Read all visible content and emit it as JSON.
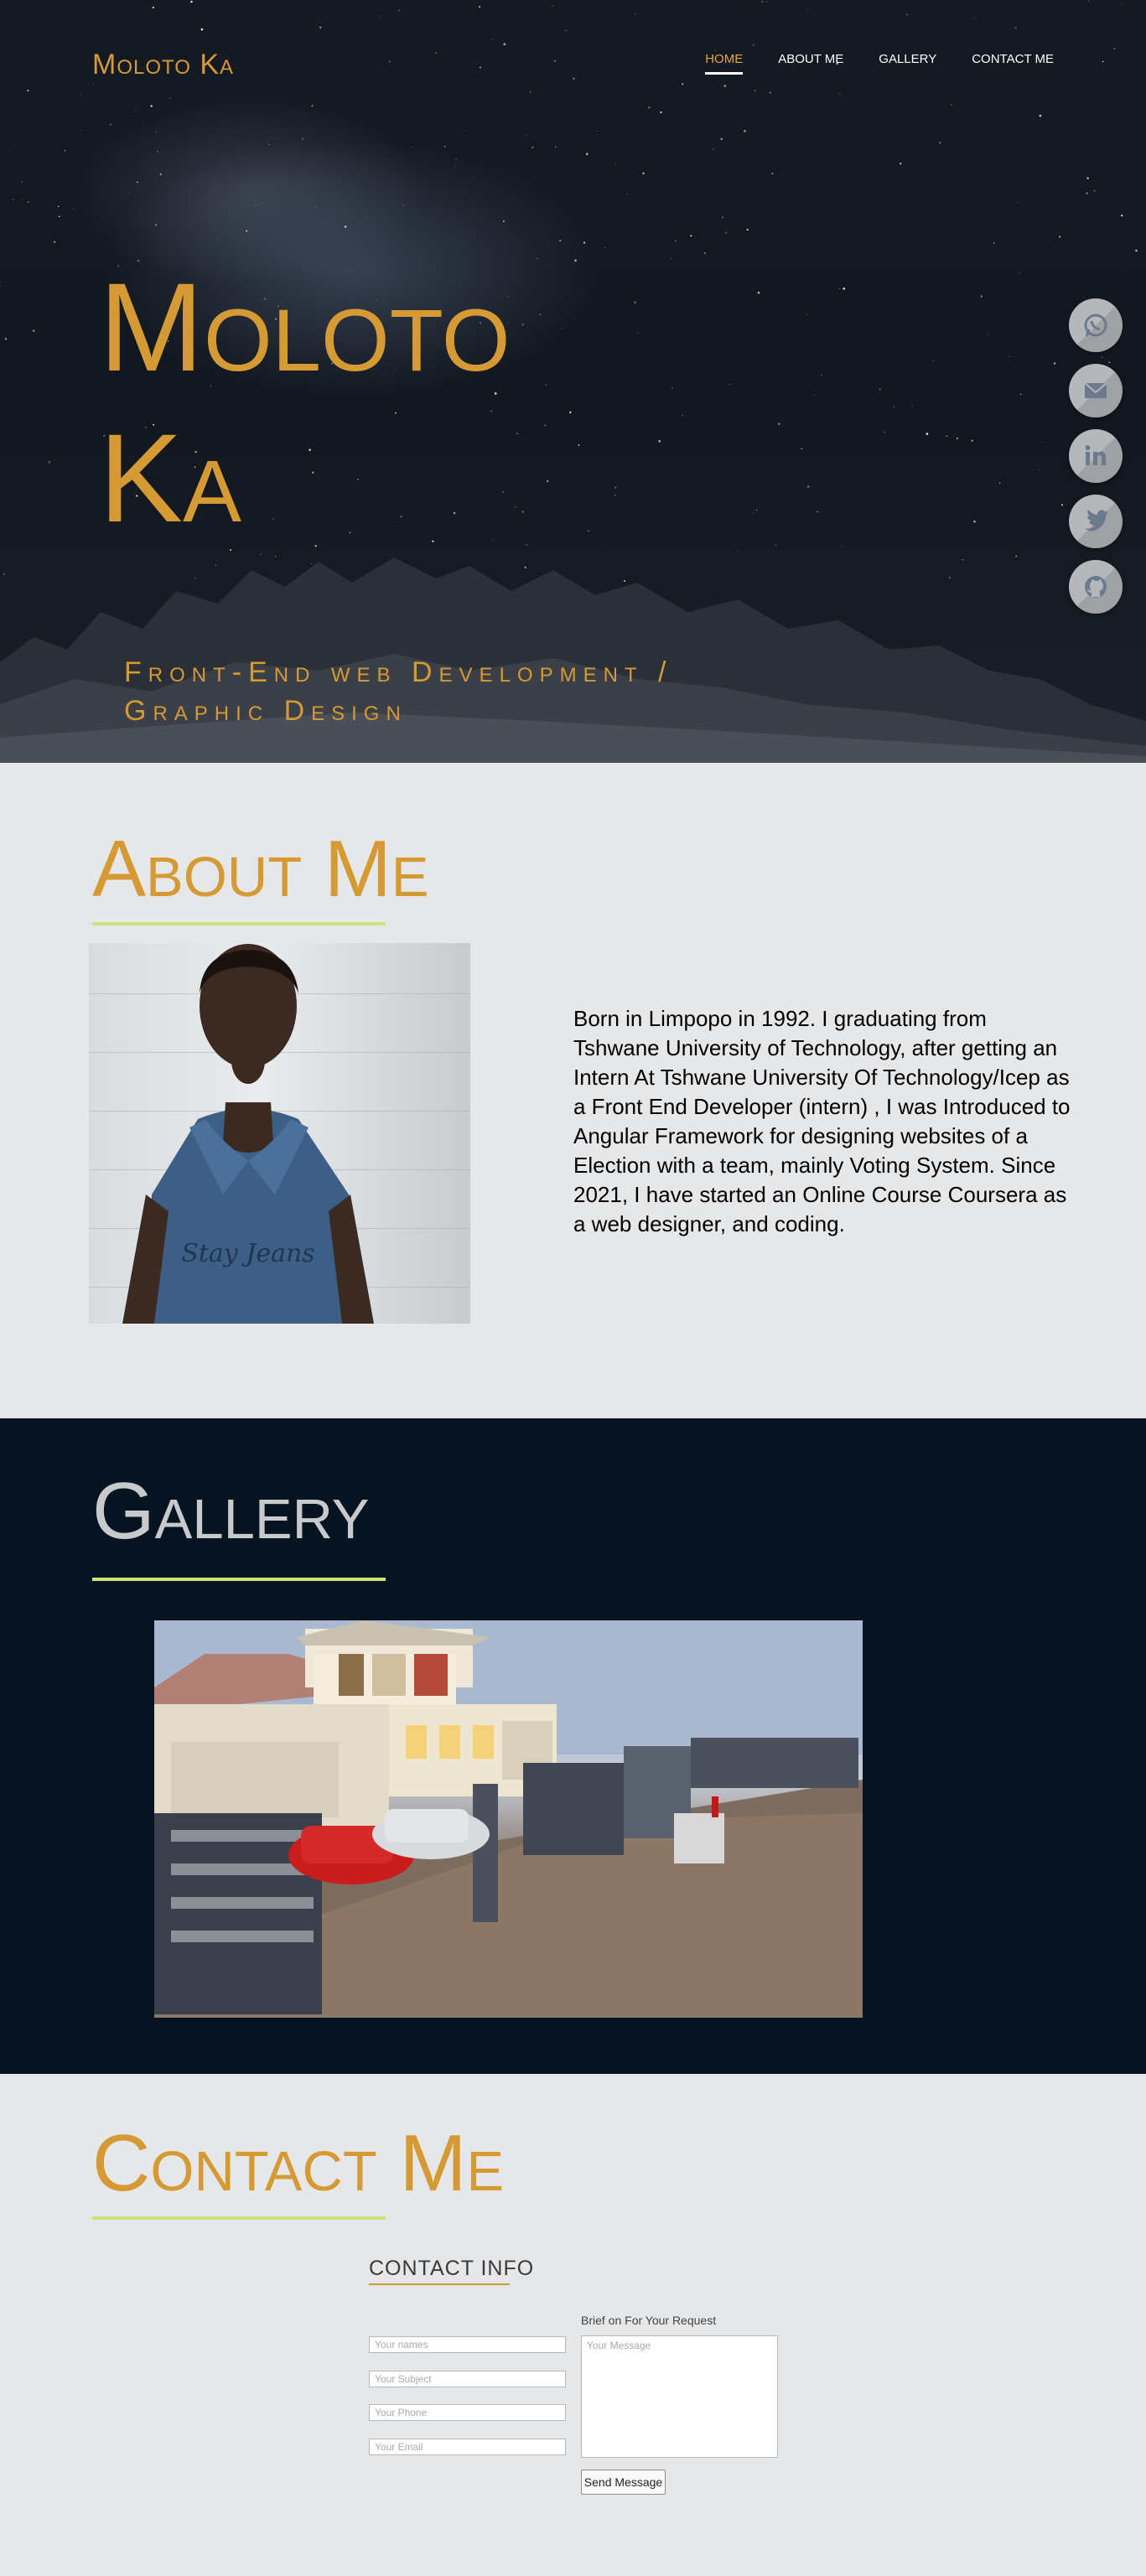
{
  "header": {
    "brand": "Moloto Ka",
    "nav": [
      {
        "label": "HOME",
        "active": true
      },
      {
        "label": "ABOUT ME",
        "active": false
      },
      {
        "label": "GALLERY",
        "active": false
      },
      {
        "label": "CONTACT ME",
        "active": false
      }
    ]
  },
  "hero": {
    "title_line1": "Moloto",
    "title_line2": "Ka",
    "subtitle_line1": "Front-End web Development /",
    "subtitle_line2": "Graphic Design",
    "social_icons": [
      "whatsapp-icon",
      "email-icon",
      "linkedin-icon",
      "twitter-icon",
      "github-icon"
    ]
  },
  "about": {
    "title": "About Me",
    "text": "Born in Limpopo in 1992. I graduating from Tshwane University of Technology, after getting an Intern At Tshwane University Of Technology/Icep as a Front End Developer (intern) , I was Introduced to Angular Framework for designing websites of a Election with a team, mainly Voting System. Since 2021, I have started an Online Course Coursera as a web designer, and coding.",
    "shirt_text": "Stay Jeans"
  },
  "gallery": {
    "title": "Gallery"
  },
  "contact": {
    "title": "Contact Me",
    "info_heading": "CONTACT INFO",
    "brief_label": "Brief on For Your Request",
    "name_placeholder": "Your names",
    "subject_placeholder": "Your Subject",
    "phone_placeholder": "Your Phone",
    "email_placeholder": "Your Email",
    "message_placeholder": "Your Message",
    "send_label": "Send Message"
  },
  "colors": {
    "accent": "#d69a34",
    "underline": "#cfe27a",
    "gallery_bg": "#061422",
    "section_bg": "#e6e7e8"
  }
}
